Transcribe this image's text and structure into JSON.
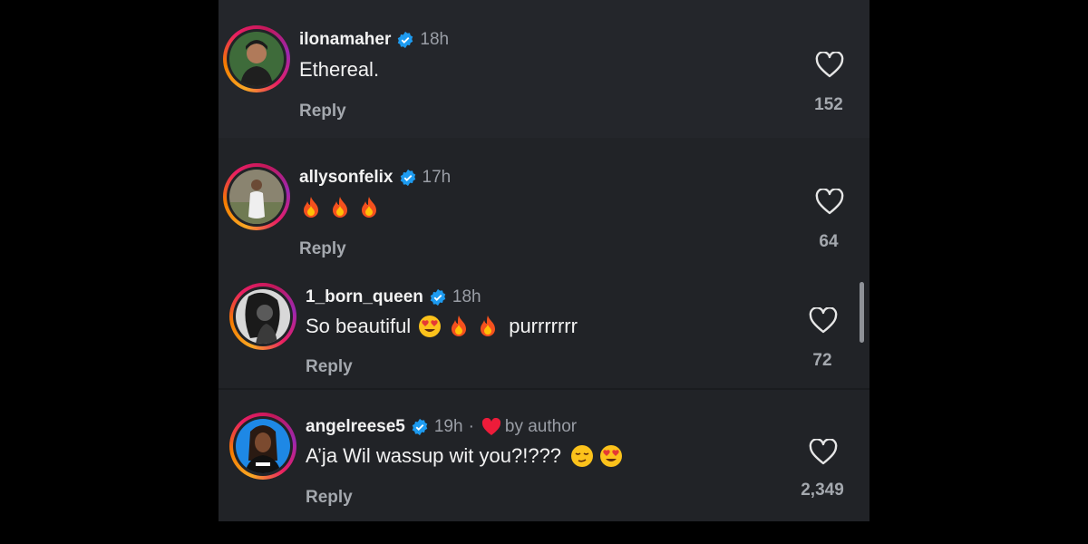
{
  "comments": [
    {
      "username": "ilonamaher",
      "time": "18h",
      "text": "Ethereal.",
      "emojis": [],
      "reply_label": "Reply",
      "likes": "152"
    },
    {
      "username": "allysonfelix",
      "time": "17h",
      "text": "",
      "emojis": [
        "fire",
        "fire",
        "fire"
      ],
      "reply_label": "Reply",
      "likes": "64"
    },
    {
      "username": "1_born_queen",
      "time": "18h",
      "text": "So beautiful",
      "text_after": "purrrrrrr",
      "emojis": [
        "heart-eyes",
        "fire",
        "fire"
      ],
      "reply_label": "Reply",
      "likes": "72"
    },
    {
      "username": "angelreese5",
      "time": "19h",
      "separator": "·",
      "liked_by": "by author",
      "text": "A’ja Wil wassup wit you?!???",
      "emojis": [
        "relieved",
        "heart-eyes"
      ],
      "reply_label": "Reply",
      "likes": "2,349"
    }
  ],
  "icons": {
    "verified": "verified-badge-icon",
    "like": "heart-outline-icon",
    "author_like": "red-heart-icon"
  },
  "colors": {
    "panel_bg": "#212327",
    "verified_blue": "#1d9bf0",
    "author_heart": "#ed1c3a"
  }
}
